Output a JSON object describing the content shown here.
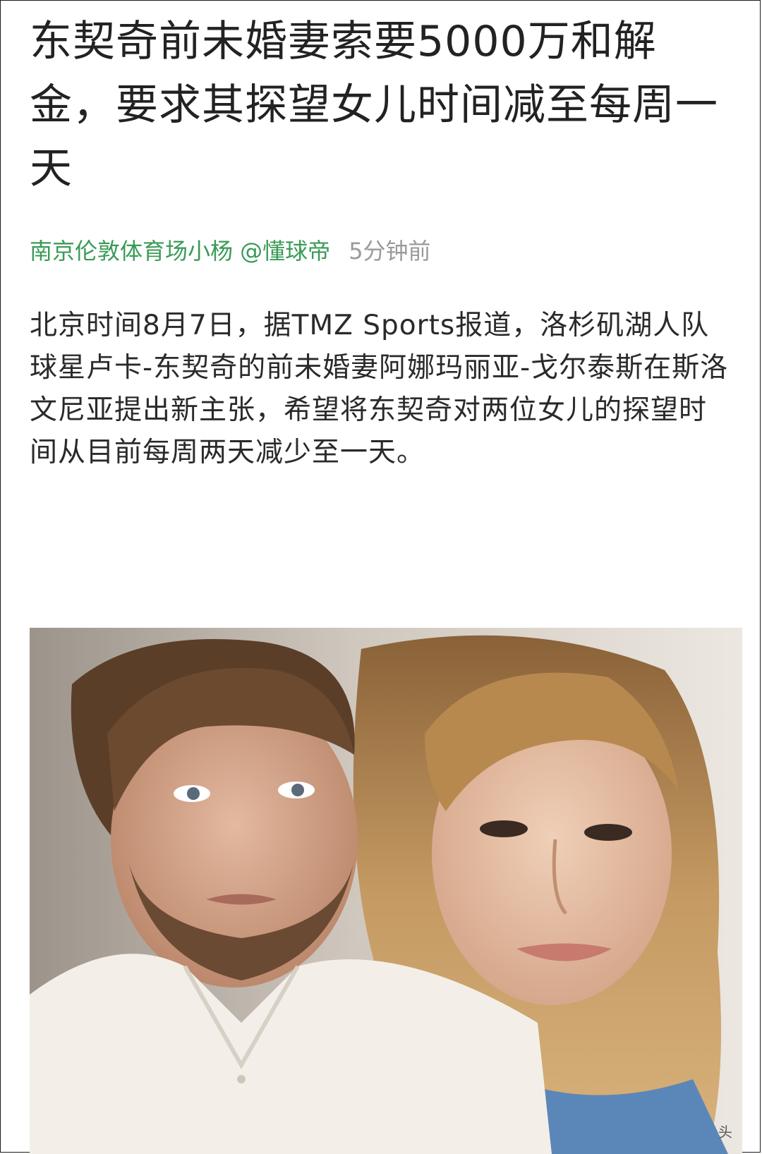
{
  "article": {
    "headline": "东契奇前未婚妻索要5000万和解金，要求其探望女儿时间减至每周一天",
    "author": "南京伦敦体育场小杨 @懂球帝",
    "time": "5分钟前",
    "body": "北京时间8月7日，据TMZ Sports报道，洛杉矶湖人队球星卢卡-东契奇的前未婚妻阿娜玛丽亚-戈尔泰斯在斯洛文尼亚提出新主张，希望将东契奇对两位女儿的探望时间从目前每周两天减少至一天。"
  },
  "image": {
    "description_icon": "photo-icon",
    "corner_text": "头"
  },
  "colors": {
    "author": "#3a9a57",
    "time": "#9a9a9a",
    "text": "#222222"
  }
}
